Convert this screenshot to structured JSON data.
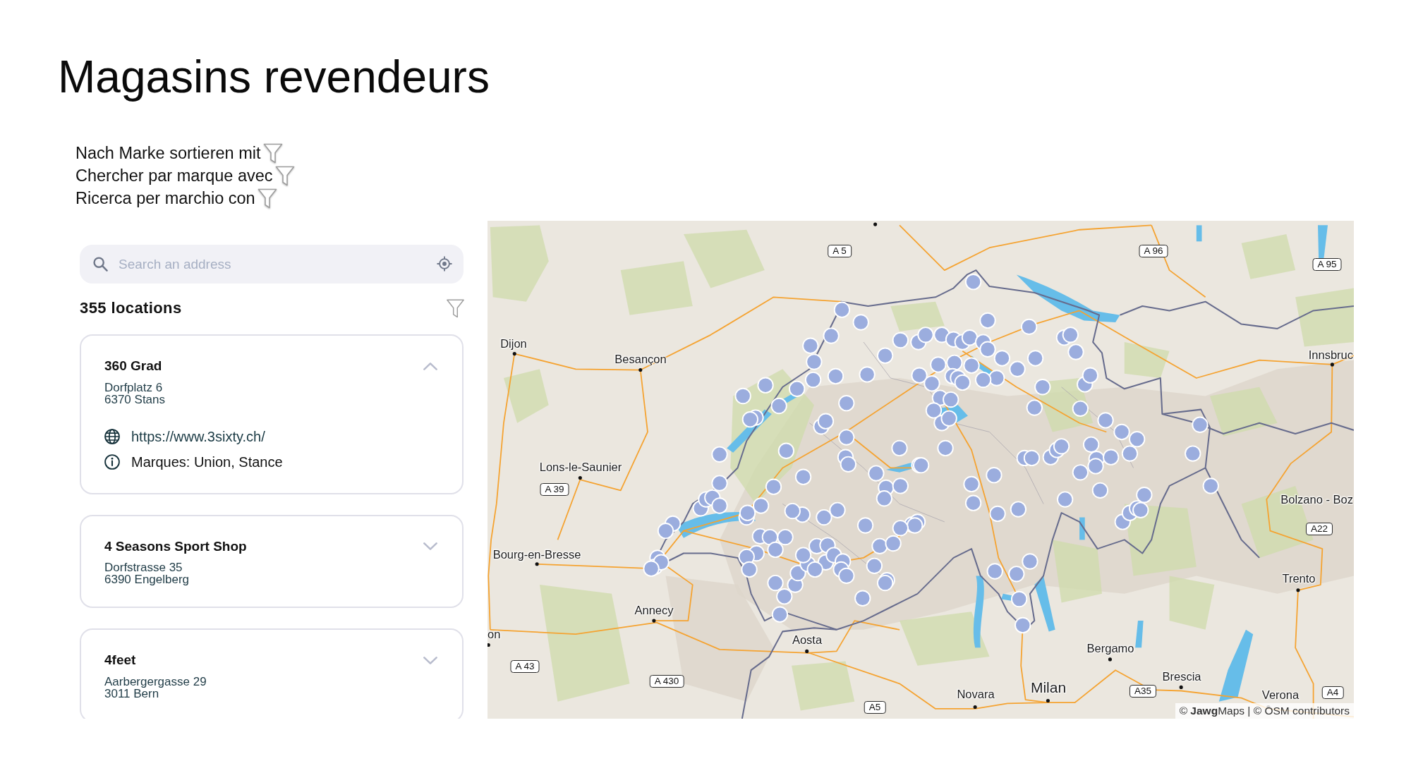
{
  "page": {
    "title": "Magasins revendeurs"
  },
  "filter_hints": [
    "Nach Marke sortieren mit",
    "Chercher par marque avec",
    "Ricerca per marchio con"
  ],
  "search": {
    "placeholder": "Search an address"
  },
  "results": {
    "count": "355 locations"
  },
  "locations": [
    {
      "name": "360 Grad",
      "address": [
        "Dorfplatz 6",
        "6370 Stans"
      ],
      "expanded": true,
      "website": "https://www.3sixty.ch/",
      "brands": "Marques: Union, Stance"
    },
    {
      "name": "4 Seasons Sport Shop",
      "address": [
        "Dorfstrasse 35",
        "6390 Engelberg"
      ],
      "expanded": false
    },
    {
      "name": "4feet",
      "address": [
        "Aarbergergasse 29",
        "3011 Bern"
      ],
      "expanded": false
    }
  ],
  "map": {
    "places": [
      {
        "name": "Dijon",
        "kind": "city"
      },
      {
        "name": "Innsbruc",
        "kind": "city"
      },
      {
        "name": "Besançon",
        "kind": "city"
      },
      {
        "name": "Lons-le-Saunier",
        "kind": "city"
      },
      {
        "name": "Bolzano - Boz",
        "kind": "city"
      },
      {
        "name": "Bourg-en-Bresse",
        "kind": "city"
      },
      {
        "name": "Trento",
        "kind": "city"
      },
      {
        "name": "Annecy",
        "kind": "city"
      },
      {
        "name": "on",
        "kind": "city"
      },
      {
        "name": "Aosta",
        "kind": "city"
      },
      {
        "name": "Bergamo",
        "kind": "city"
      },
      {
        "name": "Brescia",
        "kind": "city"
      },
      {
        "name": "Milan",
        "kind": "major_city"
      },
      {
        "name": "Novara",
        "kind": "city"
      },
      {
        "name": "Verona",
        "kind": "city"
      }
    ],
    "road_signs": [
      "A 5",
      "A 96",
      "A 95",
      "A 39",
      "A22",
      "A 43",
      "A 430",
      "A35",
      "A4",
      "A5"
    ],
    "attribution": "© **Jawg**Maps | © OSM contributors"
  }
}
